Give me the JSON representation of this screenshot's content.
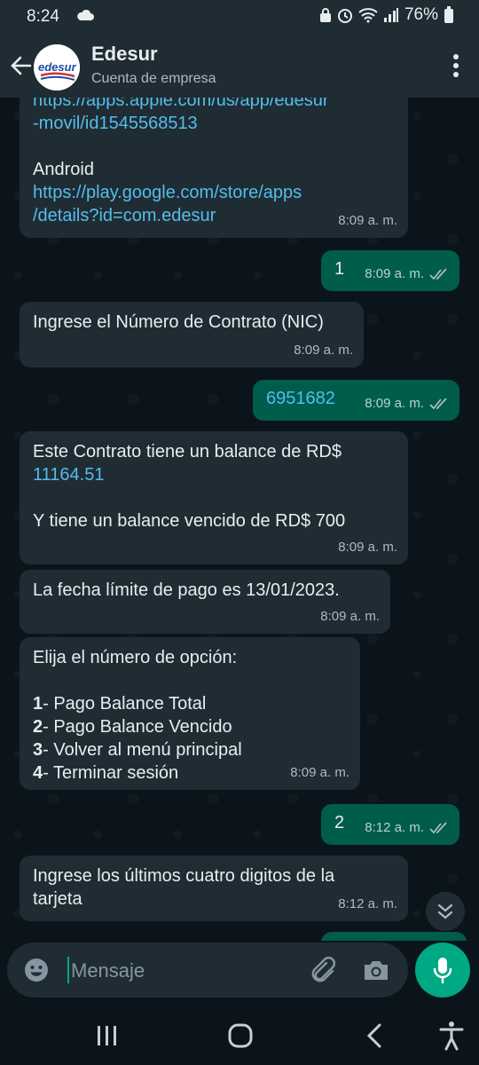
{
  "status_bar": {
    "time": "8:24",
    "battery": "76%"
  },
  "header": {
    "title": "Edesur",
    "subtitle": "Cuenta de empresa",
    "logo_text": "edesur"
  },
  "messages": [
    {
      "dir": "in",
      "lines": [
        "https://apps.apple.com/us/app/edesur",
        "-movil/id1545568513",
        "",
        "Android",
        "https://play.google.com/store/apps",
        "/details?id=com.edesur"
      ],
      "time": "8:09 a. m."
    },
    {
      "dir": "out",
      "text": "1",
      "time": "8:09 a. m."
    },
    {
      "dir": "in",
      "text": "Ingrese el Número de Contrato (NIC)",
      "time": "8:09 a. m."
    },
    {
      "dir": "out",
      "text": "6951682",
      "time": "8:09 a. m."
    },
    {
      "dir": "in",
      "line1": "Este Contrato tiene un balance de RD$",
      "line2": "11164.51",
      "line3": "Y tiene un balance vencido de RD$ 700",
      "time": "8:09 a. m."
    },
    {
      "dir": "in",
      "text": "La fecha límite de pago es 13/01/2023.",
      "time": "8:09 a. m."
    },
    {
      "dir": "in",
      "intro": "Elija el número de opción:",
      "options": [
        {
          "num": "1",
          "label": "- Pago Balance Total"
        },
        {
          "num": "2",
          "label": "- Pago Balance Vencido"
        },
        {
          "num": "3",
          "label": "- Volver al menú principal"
        },
        {
          "num": "4",
          "label": "- Terminar sesión"
        }
      ],
      "time": "8:09 a. m."
    },
    {
      "dir": "out",
      "text": "2",
      "time": "8:12 a. m."
    },
    {
      "dir": "in",
      "line1": "Ingrese los últimos cuatro digitos de la",
      "line2": "tarjeta",
      "time": "8:12 a. m."
    }
  ],
  "composer": {
    "placeholder": "Mensaje"
  },
  "colors": {
    "accent": "#00a884",
    "outgoing": "#005c4b",
    "incoming": "#202c33",
    "link": "#53bdeb"
  }
}
